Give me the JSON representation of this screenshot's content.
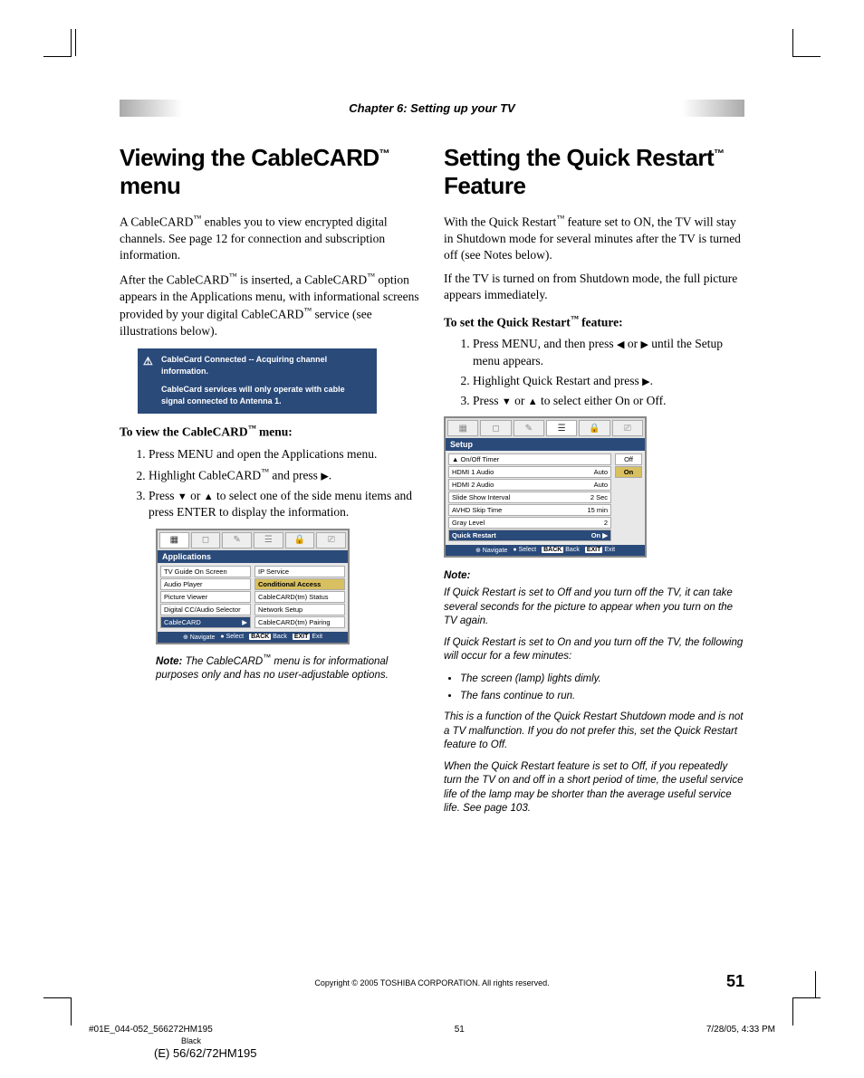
{
  "chapter": "Chapter 6: Setting up your TV",
  "left": {
    "heading_pre": "Viewing the CableCARD",
    "heading_post": " menu",
    "p1a": "A CableCARD",
    "p1b": " enables you to view encrypted digital channels. See page 12 for connection and subscription information.",
    "p2a": "After the CableCARD",
    "p2b": " is inserted, a CableCARD",
    "p2c": " option appears in the Applications menu, with informational screens provided by your digital CableCARD",
    "p2d": " service (see illustrations below).",
    "alert_l1": "CableCard Connected -- Acquiring channel information.",
    "alert_l2": "CableCard services will only operate with cable signal connected to Antenna 1.",
    "sub1a": "To view the CableCARD",
    "sub1b": " menu:",
    "s1": "Press MENU and open the Applications menu.",
    "s2a": "Highlight CableCARD",
    "s2b": " and press ",
    "s3a": "Press ",
    "s3b": " or ",
    "s3c": " to select one of the side menu items and press ENTER to display the information.",
    "osd_title": "Applications",
    "osd_left": [
      "TV Guide On Screen",
      "Audio Player",
      "Picture Viewer",
      "Digital CC/Audio Selector",
      "CableCARD"
    ],
    "osd_right": [
      "IP Service",
      "Conditional Access",
      "CableCARD(tm) Status",
      "Network Setup",
      "CableCARD(tm) Pairing"
    ],
    "osd_nav": "Navigate",
    "osd_sel": "Select",
    "osd_back": "Back",
    "osd_exit": "Exit",
    "note_label": "Note:",
    "note_a": " The CableCARD",
    "note_b": " menu is for informational purposes only and has no user-adjustable options."
  },
  "right": {
    "heading_pre": "Setting the Quick Restart",
    "heading_post": " Feature",
    "p1a": "With the Quick Restart",
    "p1b": " feature set to ON, the TV will stay in Shutdown mode for several minutes after the TV is turned off (see Notes below).",
    "p2": "If the TV is turned on from Shutdown mode, the full picture appears immediately.",
    "sub1a": "To set the Quick Restart",
    "sub1b": " feature:",
    "s1a": "Press MENU, and then press ",
    "s1b": " or ",
    "s1c": " until the Setup menu appears.",
    "s2a": "Highlight Quick Restart and press ",
    "s3a": "Press ",
    "s3b": " or ",
    "s3c": " to select either On or Off.",
    "osd_title": "Setup",
    "osd_rows": [
      {
        "l": "On/Off Timer",
        "r": ""
      },
      {
        "l": "HDMI 1 Audio",
        "r": "Auto"
      },
      {
        "l": "HDMI 2 Audio",
        "r": "Auto"
      },
      {
        "l": "Slide Show Interval",
        "r": "2 Sec"
      },
      {
        "l": "AVHD Skip Time",
        "r": "15 min"
      },
      {
        "l": "Gray Level",
        "r": "2"
      },
      {
        "l": "Quick Restart",
        "r": "On"
      }
    ],
    "osd_side": [
      "Off",
      "On"
    ],
    "note_h": "Note:",
    "n1": "If Quick Restart is set to Off and you turn off the TV, it can take several seconds for the picture to appear when you turn on the TV again.",
    "n2": "If Quick Restart is set to On and you turn off the TV, the following will occur for a few minutes:",
    "b1": "The screen (lamp) lights dimly.",
    "b2": "The fans continue to run.",
    "n3": "This is a function of the Quick Restart Shutdown mode and is not a TV malfunction. If you do not prefer this, set the Quick Restart feature to Off.",
    "n4": "When the Quick Restart feature is set to Off, if you repeatedly turn the TV on and off in a short period of time, the useful service life of the lamp may be shorter than the average useful service life. See page 103."
  },
  "footer": {
    "copyright": "Copyright © 2005 TOSHIBA CORPORATION. All rights reserved.",
    "page_num": "51",
    "print_file": "#01E_044-052_566272HM195",
    "print_page": "51",
    "print_date": "7/28/05, 4:33 PM",
    "print_black": "Black",
    "print_model": "(E) 56/62/72HM195"
  },
  "osd_keys": {
    "menu": "MENU",
    "back_key": "BACK",
    "exit_key": "EXIT",
    "enter": "●"
  }
}
